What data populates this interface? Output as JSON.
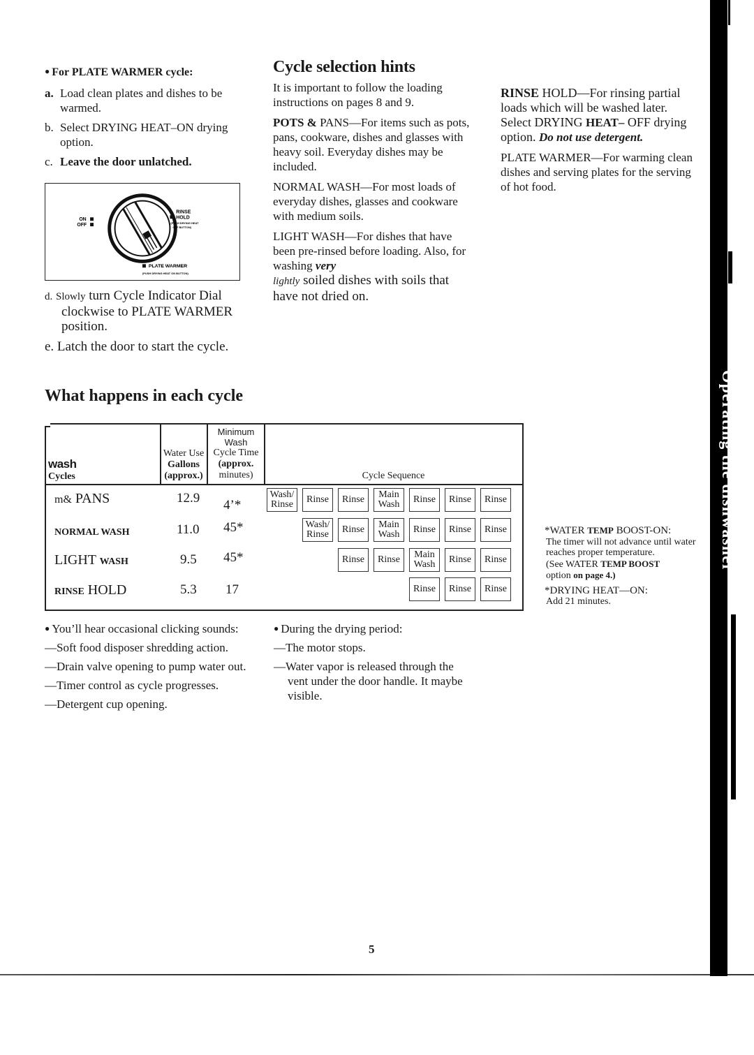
{
  "page": {
    "page_number": "5",
    "side_tab_label": "Operating the dishwasher"
  },
  "plate_warmer": {
    "heading_prefix": "For ",
    "heading_bold": "PLATE WARMER cycle:",
    "steps": [
      {
        "label": "a.",
        "text": "Load clean plates and dishes to be warmed."
      },
      {
        "label": "b.",
        "text": "Select DRYING HEAT–ON drying option."
      },
      {
        "label": "c.",
        "text": "Leave the door unlatched."
      }
    ],
    "step_d_label": "d.",
    "step_d_small": "Slowly",
    "step_d_text": "turn Cycle Indicator Dial clockwise to PLATE WARMER position.",
    "step_e": "e. Latch the door to start the cycle.",
    "dial": {
      "on_label": "ON",
      "off_label": "OFF",
      "rinse_hold_line1": "RINSE",
      "rinse_hold_line2": "HOLD",
      "rinse_hold_note_line1": "(PUSH DRYING HEAT",
      "rinse_hold_note_line2": "OFF BUTTON)",
      "plate_warmer_label": "PLATE WARMER",
      "plate_warmer_note": "(PUSH DRYING HEAT ON BUTTON)"
    }
  },
  "cycle_hints": {
    "title": "Cycle selection hints",
    "intro": "It is important to follow the loading instructions on pages 8 and 9.",
    "pots_bold": "POTS &",
    "pots_text": " PANS—For items such as pots, pans, cookware, dishes and glasses with heavy soil. Everyday dishes may be included.",
    "normal": "NORMAL WASH—For most loads of everyday dishes, glasses and cookware with medium soils.",
    "light_a": "LIGHT WASH—For dishes that have been pre-rinsed before loading. Also, for washing ",
    "light_very": "very",
    "light_lightly": "lightly",
    "light_b": " soiled dishes with soils that have not dried on.",
    "rinse_bold": "RINSE",
    "rinse_a": " HOLD—For rinsing partial loads which will be washed later. Select DRYING ",
    "rinse_heat": "HEAT–",
    "rinse_b": " OFF drying option. ",
    "rinse_italic": "Do not use detergent.",
    "plate": "PLATE WARMER—For warming clean dishes and serving plates for the serving of hot food."
  },
  "cycle_table": {
    "title": "What happens in each cycle",
    "headers": {
      "cycles_line1": "wash",
      "cycles_line2": "Cycles",
      "water_line1": "Water Use",
      "water_line2": "Gallons",
      "water_line3": "(approx.)",
      "time_line1": "Minimum",
      "time_line2": "Wash",
      "time_line3": "Cycle Time",
      "time_line4": "(approx.",
      "time_line5": "minutes)",
      "sequence": "Cycle Sequence"
    },
    "rows": [
      {
        "name_small": "m&",
        "name_big": " PANS",
        "gallons": "12.9",
        "minutes": "4’*",
        "sequence": [
          "Wash/ Rinse",
          "Rinse",
          "Rinse",
          "Main Wash",
          "Rinse",
          "Rinse",
          "Rinse"
        ]
      },
      {
        "name_small": "NORMAL WASH",
        "name_big": "",
        "gallons": "11.0",
        "minutes": "45*",
        "sequence": [
          "Wash/ Rinse",
          "Rinse",
          "Main Wash",
          "Rinse",
          "Rinse",
          "Rinse"
        ]
      },
      {
        "name_small": "WASH",
        "name_big": "LIGHT ",
        "gallons": "9.5",
        "minutes": "45*",
        "sequence": [
          "Rinse",
          "Rinse",
          "Main Wash",
          "Rinse",
          "Rinse"
        ]
      },
      {
        "name_small": "RINSE",
        "name_big": " HOLD",
        "gallons": "5.3",
        "minutes": "17",
        "sequence": [
          "Rinse",
          "Rinse",
          "Rinse"
        ]
      }
    ],
    "notes": {
      "boost_head_a": "*WATER ",
      "boost_head_b": "TEMP",
      "boost_head_c": " BOOST-ON:",
      "boost_body": "The timer will not advance until water reaches proper temperature.",
      "boost_see_a": "(See WATER ",
      "boost_see_b": "TEMP BOOST",
      "boost_option_a": "option ",
      "boost_option_b": "on page 4.)",
      "drying_head": "*DRYING HEAT—ON:",
      "drying_body": "Add 21 minutes."
    }
  },
  "sounds": {
    "intro": "You’ll hear occasional clicking sounds:",
    "items": [
      "—Soft food disposer shredding action.",
      "—Drain valve opening to pump water out.",
      "—Timer control as cycle progresses.",
      "—Detergent cup opening."
    ]
  },
  "drying": {
    "intro": "During the drying period:",
    "items": [
      "—The motor stops.",
      "—Water vapor is released through the vent under the door handle. It maybe visible."
    ]
  }
}
